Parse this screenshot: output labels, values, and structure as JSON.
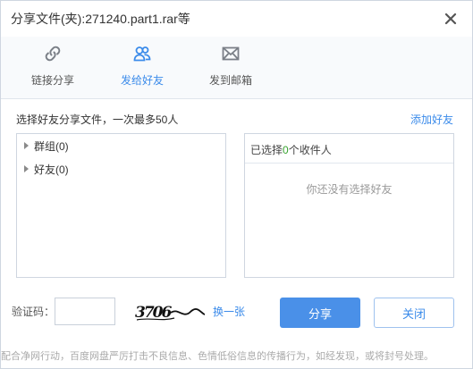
{
  "dialog": {
    "title": "分享文件(夹):271240.part1.rar等",
    "close_icon": "close-icon"
  },
  "tabs": [
    {
      "label": "链接分享",
      "icon": "link-icon",
      "active": false
    },
    {
      "label": "发给好友",
      "icon": "friends-icon",
      "active": true
    },
    {
      "label": "发到邮箱",
      "icon": "mail-icon",
      "active": false
    }
  ],
  "friends": {
    "hint": "选择好友分享文件，一次最多50人",
    "add_friend": "添加好友",
    "groups": [
      {
        "label": "群组(0)"
      },
      {
        "label": "好友(0)"
      }
    ]
  },
  "recipients": {
    "prefix": "已选择",
    "count": "0",
    "suffix": "个收件人",
    "empty_message": "你还没有选择好友"
  },
  "captcha": {
    "label": "验证码：",
    "value": "",
    "placeholder": "",
    "refresh": "换一张",
    "image_text": "3706"
  },
  "buttons": {
    "share": "分享",
    "close": "关闭"
  },
  "notice": "配合净网行动，百度网盘严厉打击不良信息、色情低俗信息的传播行为，如经发现，或将封号处理。",
  "colors": {
    "accent": "#3b8bea",
    "primary_button": "#4a90e8",
    "count": "#37a32f"
  }
}
